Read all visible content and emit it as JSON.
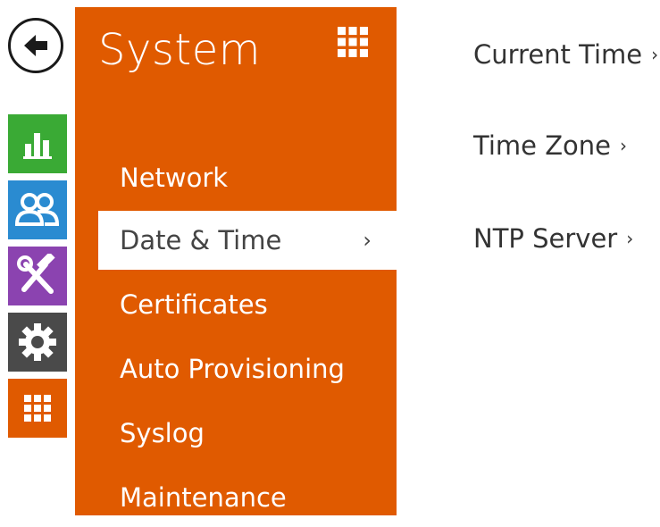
{
  "colors": {
    "system_orange": "#e05a00",
    "status_green": "#3aaa35",
    "directory_blue": "#2a8bd1",
    "services_purple": "#8b43b0",
    "hardware_gray": "#4a4a4a",
    "system_orange_rail": "#e05a00"
  },
  "back": {
    "icon": "arrow-left-icon"
  },
  "rail": [
    {
      "icon": "bar-chart-icon",
      "color": "#3aaa35"
    },
    {
      "icon": "users-icon",
      "color": "#2a8bd1"
    },
    {
      "icon": "tools-icon",
      "color": "#8b43b0"
    },
    {
      "icon": "gear-icon",
      "color": "#4a4a4a"
    },
    {
      "icon": "grid-icon",
      "color": "#e05a00"
    }
  ],
  "panel": {
    "title": "System",
    "title_icon": "grid-icon",
    "menu": [
      {
        "label": "Network"
      },
      {
        "label": "Date & Time",
        "active": true,
        "chevron": "›"
      },
      {
        "label": "Certificates"
      },
      {
        "label": "Auto Provisioning"
      },
      {
        "label": "Syslog"
      },
      {
        "label": "Maintenance"
      }
    ]
  },
  "content": {
    "links": [
      {
        "label": "Current Time",
        "chevron": "›"
      },
      {
        "label": "Time Zone",
        "chevron": "›"
      },
      {
        "label": "NTP Server",
        "chevron": "›"
      }
    ]
  }
}
